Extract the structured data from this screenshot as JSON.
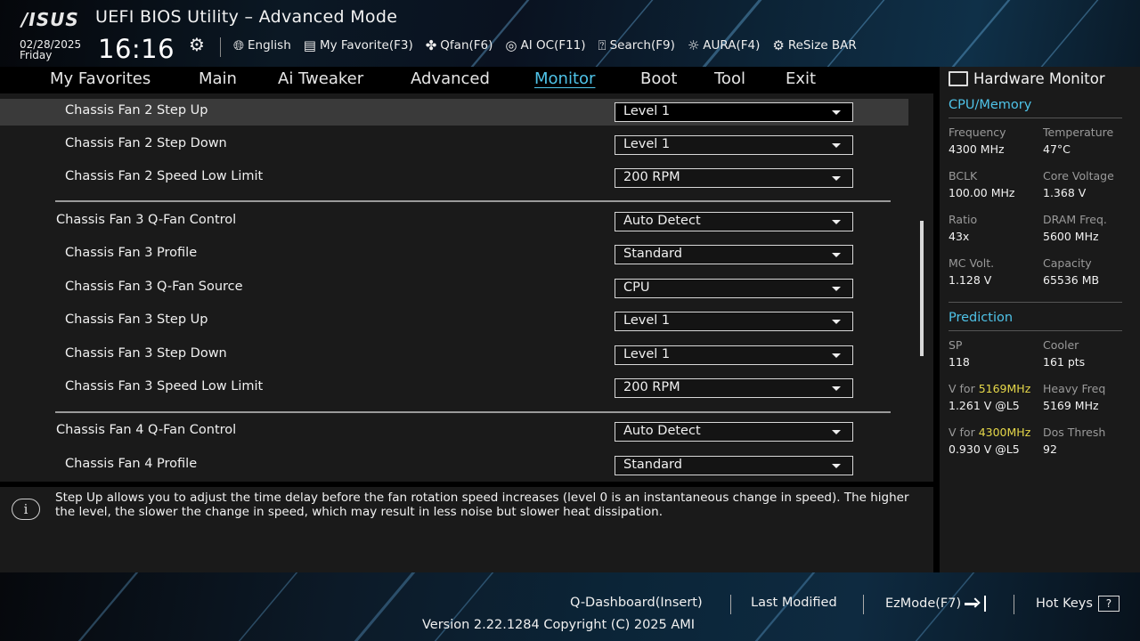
{
  "header": {
    "logo": "/ISUS",
    "title": "UEFI BIOS Utility – Advanced Mode",
    "date": "02/28/2025",
    "day": "Friday",
    "time": "16:16",
    "toolbar": [
      {
        "icon": "globe-icon",
        "label": "English"
      },
      {
        "icon": "favorite-icon",
        "label": "My Favorite(F3)"
      },
      {
        "icon": "fan-icon",
        "label": "Qfan(F6)"
      },
      {
        "icon": "ai-oc-icon",
        "label": "AI OC(F11)"
      },
      {
        "icon": "search-icon",
        "label": "Search(F9)"
      },
      {
        "icon": "aura-icon",
        "label": "AURA(F4)"
      },
      {
        "icon": "resize-bar-icon",
        "label": "ReSize BAR"
      }
    ]
  },
  "nav": {
    "tabs": [
      "My Favorites",
      "Main",
      "Ai Tweaker",
      "Advanced",
      "Monitor",
      "Boot",
      "Tool",
      "Exit"
    ],
    "active": "Monitor"
  },
  "settings": [
    {
      "label": "Chassis Fan 2 Step Up",
      "value": "Level 1",
      "selected": true
    },
    {
      "label": "Chassis Fan 2 Step Down",
      "value": "Level 1"
    },
    {
      "label": "Chassis Fan 2 Speed Low Limit",
      "value": "200 RPM"
    },
    {
      "label": "Chassis Fan 3 Q-Fan Control",
      "value": "Auto Detect"
    },
    {
      "label": "Chassis Fan 3 Profile",
      "value": "Standard"
    },
    {
      "label": "Chassis Fan 3 Q-Fan Source",
      "value": "CPU"
    },
    {
      "label": "Chassis Fan 3 Step Up",
      "value": "Level 1"
    },
    {
      "label": "Chassis Fan 3 Step Down",
      "value": "Level 1"
    },
    {
      "label": "Chassis Fan 3 Speed Low Limit",
      "value": "200 RPM"
    },
    {
      "label": "Chassis Fan 4 Q-Fan Control",
      "value": "Auto Detect"
    },
    {
      "label": "Chassis Fan 4 Profile",
      "value": "Standard"
    }
  ],
  "help": {
    "text": "Step Up allows you to adjust the time delay before the fan rotation speed increases (level 0 is an instantaneous change in speed). The higher the level, the slower the change in speed, which may result in less noise but slower heat dissipation."
  },
  "hardware_monitor": {
    "title": "Hardware Monitor",
    "cpu_memory": {
      "heading": "CPU/Memory",
      "frequency_label": "Frequency",
      "frequency": "4300 MHz",
      "temperature_label": "Temperature",
      "temperature": "47°C",
      "bclk_label": "BCLK",
      "bclk": "100.00 MHz",
      "core_voltage_label": "Core Voltage",
      "core_voltage": "1.368 V",
      "ratio_label": "Ratio",
      "ratio": "43x",
      "dram_freq_label": "DRAM Freq.",
      "dram_freq": "5600 MHz",
      "mc_volt_label": "MC Volt.",
      "mc_volt": "1.128 V",
      "capacity_label": "Capacity",
      "capacity": "65536 MB"
    },
    "prediction": {
      "heading": "Prediction",
      "sp_label": "SP",
      "sp": "118",
      "cooler_label": "Cooler",
      "cooler": "161 pts",
      "v_for_label": "V for",
      "freq_1": "5169MHz",
      "v_1": "1.261 V @L5",
      "heavy_freq_label": "Heavy Freq",
      "heavy_freq": "5169 MHz",
      "freq_2": "4300MHz",
      "v_2": "0.930 V @L5",
      "dos_thresh_label": "Dos Thresh",
      "dos_thresh": "92"
    }
  },
  "footer": {
    "q_dashboard": "Q-Dashboard(Insert)",
    "last_modified": "Last Modified",
    "ezmode": "EzMode(F7)",
    "hot_keys": "Hot Keys",
    "hot_keys_icon": "?",
    "version": "Version 2.22.1284 Copyright (C) 2025 AMI"
  }
}
